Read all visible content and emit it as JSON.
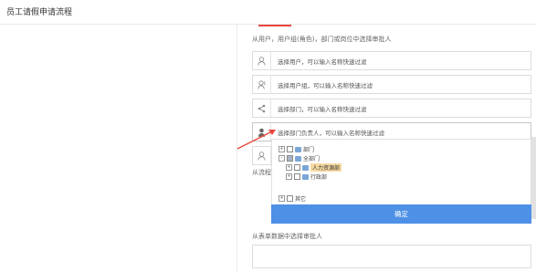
{
  "window": {
    "title": "员工请假申请流程"
  },
  "sections": {
    "users_label": "从用户，用户组(角色)，部门或岗位中选择审批人",
    "flow_label": "从流程中",
    "form_label": "从表单数据中选择审批人"
  },
  "fields": [
    {
      "icon": "user-icon",
      "placeholder": "选择用户，可以输入名称快速过滤"
    },
    {
      "icon": "user-group-icon",
      "placeholder": "选择用户组，可以输入名称快速过滤"
    },
    {
      "icon": "share-nodes-icon",
      "placeholder": "选择部门，可以输入名称快速过滤"
    },
    {
      "icon": "user-solid-icon",
      "placeholder": "选择部门负责人，可以输入名称快速过滤"
    },
    {
      "icon": "user-outline-icon",
      "placeholder": ""
    }
  ],
  "tree": {
    "nodes": [
      {
        "label": "部门",
        "level": 0,
        "checked": false
      },
      {
        "label": "全部门",
        "level": 0,
        "checked": "partial"
      },
      {
        "label": "人力资源部",
        "level": 1,
        "checked": false,
        "highlight": true
      },
      {
        "label": "行政部",
        "level": 1,
        "checked": false
      },
      {
        "label": "其它",
        "level": 0,
        "checked": false
      }
    ]
  },
  "buttons": {
    "confirm": "确定"
  },
  "colors": {
    "accent": "#e8473d",
    "primary": "#4d90e6"
  }
}
